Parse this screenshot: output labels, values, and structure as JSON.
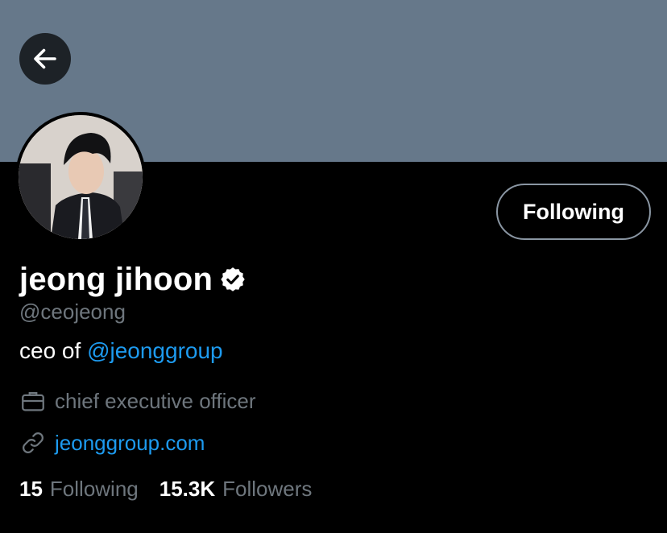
{
  "profile": {
    "display_name": "jeong jihoon",
    "handle": "@ceojeong",
    "bio_text": "ceo of ",
    "bio_mention": "@jeonggroup",
    "job": "chief executive officer",
    "website": "jeonggroup.com",
    "verified": true
  },
  "actions": {
    "follow_label": "Following"
  },
  "stats": {
    "following_count": "15",
    "following_label": "Following",
    "followers_count": "15.3K",
    "followers_label": "Followers"
  },
  "colors": {
    "banner": "#66788a",
    "background": "#000000",
    "accent": "#1d9bf0",
    "muted_text": "#6e767d"
  },
  "icons": {
    "back": "arrow-left-icon",
    "verified": "verified-badge-icon",
    "job": "briefcase-icon",
    "website": "link-icon"
  }
}
